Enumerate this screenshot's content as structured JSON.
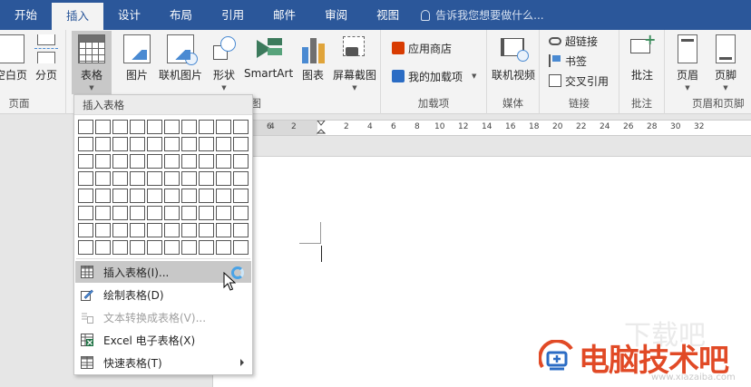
{
  "tabs": [
    {
      "label": "开始",
      "active": false
    },
    {
      "label": "插入",
      "active": true
    },
    {
      "label": "设计",
      "active": false
    },
    {
      "label": "布局",
      "active": false
    },
    {
      "label": "引用",
      "active": false
    },
    {
      "label": "邮件",
      "active": false
    },
    {
      "label": "审阅",
      "active": false
    },
    {
      "label": "视图",
      "active": false
    }
  ],
  "tellme": {
    "placeholder": "告诉我您想要做什么..."
  },
  "ribbon": {
    "pages_group": {
      "label": "页面",
      "blank_page": "空白页",
      "page_break": "分页"
    },
    "tables_group": {
      "table_button": "表格"
    },
    "illustrations_group": {
      "label": "插图",
      "picture": "图片",
      "online_picture": "联机图片",
      "shapes": "形状",
      "smartart": "SmartArt",
      "chart": "图表",
      "screenshot": "屏幕截图"
    },
    "addins_group": {
      "label": "加载项",
      "store": "应用商店",
      "my_addins": "我的加载项"
    },
    "media_group": {
      "label": "媒体",
      "online_video": "联机视频"
    },
    "links_group": {
      "label": "链接",
      "hyperlink": "超链接",
      "bookmark": "书签",
      "cross_reference": "交叉引用"
    },
    "comments_group": {
      "label": "批注",
      "comment": "批注"
    },
    "header_footer_group": {
      "label": "页眉和页脚",
      "header": "页眉",
      "footer": "页脚"
    }
  },
  "ruler": {
    "ticks": [
      "6",
      "4",
      "2",
      "2",
      "4",
      "6",
      "8",
      "10",
      "12",
      "14",
      "16",
      "18",
      "20",
      "22",
      "24",
      "26",
      "28",
      "30",
      "32"
    ]
  },
  "table_menu": {
    "title": "插入表格",
    "grid_cols": 10,
    "grid_rows": 8,
    "items": [
      {
        "label": "插入表格(I)...",
        "highlighted": true,
        "disabled": false
      },
      {
        "label": "绘制表格(D)",
        "highlighted": false,
        "disabled": false
      },
      {
        "label": "文本转换成表格(V)...",
        "highlighted": false,
        "disabled": true
      },
      {
        "label": "Excel 电子表格(X)",
        "highlighted": false,
        "disabled": false
      },
      {
        "label": "快速表格(T)",
        "highlighted": false,
        "disabled": false
      }
    ]
  },
  "watermark": {
    "text": "电脑技术吧",
    "url": "www.xiazaiba.com",
    "ghost": "下载吧"
  },
  "colors": {
    "accent": "#2b579a",
    "watermark": "#e14a26"
  }
}
